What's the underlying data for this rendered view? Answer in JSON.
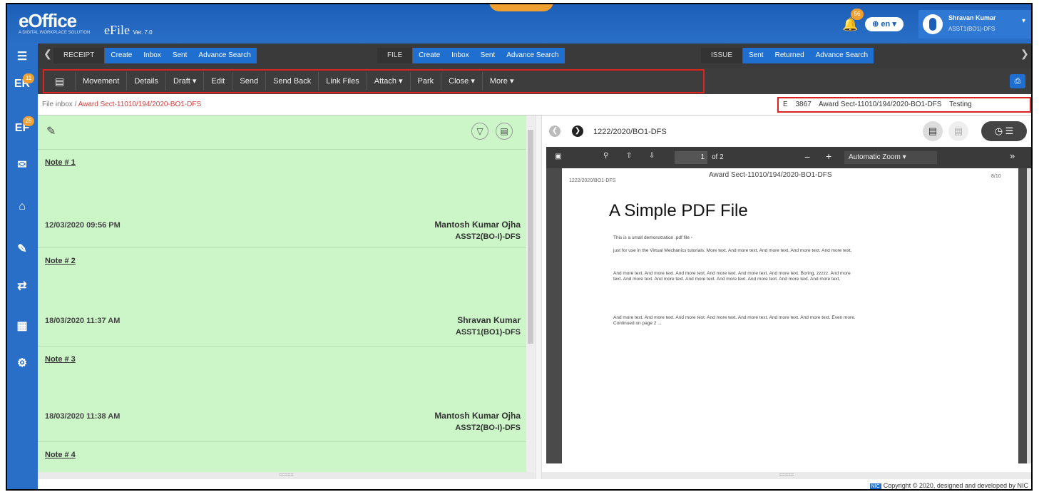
{
  "brand": {
    "logo": "eOffice",
    "logo_sub": "A DIGITAL WORKPLACE SOLUTION",
    "app": "eFile",
    "version": "Ver. 7.0"
  },
  "header": {
    "notification_count": "56",
    "language": "en",
    "user_name": "Shravan Kumar",
    "user_designation": "ASST1(BO1)-DFS"
  },
  "sidebar": {
    "badges": [
      "11",
      "28"
    ]
  },
  "nav": {
    "receipt": {
      "label": "RECEIPT",
      "links": [
        "Create",
        "Inbox",
        "Sent",
        "Advance Search"
      ]
    },
    "file": {
      "label": "FILE",
      "links": [
        "Create",
        "Inbox",
        "Sent",
        "Advance Search"
      ]
    },
    "issue": {
      "label": "ISSUE",
      "links": [
        "Sent",
        "Returned",
        "Advance Search"
      ]
    }
  },
  "toolbar": [
    "Movement",
    "Details",
    "Draft ▾",
    "Edit",
    "Send",
    "Send Back",
    "Link Files",
    "Attach ▾",
    "Park",
    "Close ▾",
    "More ▾"
  ],
  "breadcrumb": {
    "root": "File inbox",
    "current": "Award Sect-11010/194/2020-BO1-DFS"
  },
  "file_info": {
    "type": "E",
    "number": "3867",
    "subject": "Award Sect-11010/194/2020-BO1-DFS",
    "tag": "Testing"
  },
  "notes": [
    {
      "title": "Note # 1",
      "date": "12/03/2020 09:56 PM",
      "name": "Mantosh Kumar Ojha",
      "designation": "ASST2(BO-I)-DFS"
    },
    {
      "title": "Note # 2",
      "date": "18/03/2020 11:37 AM",
      "name": "Shravan Kumar",
      "designation": "ASST1(BO1)-DFS"
    },
    {
      "title": "Note # 3",
      "date": "18/03/2020 11:38 AM",
      "name": "Mantosh Kumar Ojha",
      "designation": "ASST2(BO-I)-DFS"
    },
    {
      "title": "Note # 4",
      "date": "",
      "name": "",
      "designation": ""
    }
  ],
  "viewer": {
    "title": "1222/2020/BO1-DFS",
    "page": "1",
    "of_pages": "of 2",
    "zoom": "Automatic Zoom",
    "pdf": {
      "header_left": "1222/2020/BO1-DFS",
      "header_center": "Award Sect-11010/194/2020-BO1-DFS",
      "header_right": "8/10",
      "heading": "A Simple PDF File",
      "p1": "This is a small demonstration .pdf file -",
      "p2": "just for use in the Virtual Mechanics tutorials. More text. And more text. And more text. And more text. And more text.",
      "p3": "And more text. And more text. And more text. And more text. And more text. And more text. Boring, zzzzz. And more text. And more text. And more text. And more text. And more text. And more text. And more text. And more text.",
      "p4": "And more text. And more text. And more text. And more text. And more text. And more text. And more text. Even more. Continued on page 2 ..."
    }
  },
  "footer": {
    "badge": "NIC",
    "text": "Copyright © 2020, designed and developed by NIC"
  }
}
